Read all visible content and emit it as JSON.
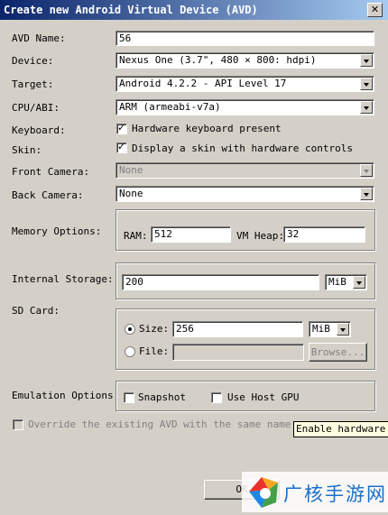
{
  "window": {
    "title": "Create new Android Virtual Device (AVD)",
    "close_glyph": "✕"
  },
  "avd_name": {
    "label": "AVD Name:",
    "value": "56"
  },
  "device": {
    "label": "Device:",
    "value": "Nexus One (3.7\", 480 × 800: hdpi)"
  },
  "target": {
    "label": "Target:",
    "value": "Android 4.2.2 - API Level 17"
  },
  "cpu_abi": {
    "label": "CPU/ABI:",
    "value": "ARM (armeabi-v7a)"
  },
  "keyboard": {
    "label": "Keyboard:",
    "option": "Hardware keyboard present",
    "checked": true
  },
  "skin": {
    "label": "Skin:",
    "option": "Display a skin with hardware controls",
    "checked": true
  },
  "front_camera": {
    "label": "Front Camera:",
    "value": "None"
  },
  "back_camera": {
    "label": "Back Camera:",
    "value": "None"
  },
  "memory": {
    "label": "Memory Options:",
    "ram_label": "RAM:",
    "ram_value": "512",
    "vm_heap_label": "VM Heap:",
    "vm_heap_value": "32"
  },
  "internal_storage": {
    "label": "Internal Storage:",
    "value": "200",
    "unit": "MiB"
  },
  "sd_card": {
    "label": "SD Card:",
    "size_label": "Size:",
    "size_value": "256",
    "size_unit": "MiB",
    "file_label": "File:",
    "file_value": "",
    "browse_label": "Browse..."
  },
  "emulation": {
    "label": "Emulation Options:",
    "snapshot_label": "Snapshot",
    "host_gpu_label": "Use Host GPU"
  },
  "override": {
    "label": "Override the existing AVD with the same name"
  },
  "tooltip": {
    "text": "Enable hardware O"
  },
  "ok_button": {
    "label": "OK"
  },
  "watermark": {
    "text": "广核手游网"
  },
  "colors": {
    "title_start": "#0a246a",
    "title_end": "#a6caf0",
    "face": "#d4d0c8",
    "tooltip_bg": "#ffffe1"
  }
}
